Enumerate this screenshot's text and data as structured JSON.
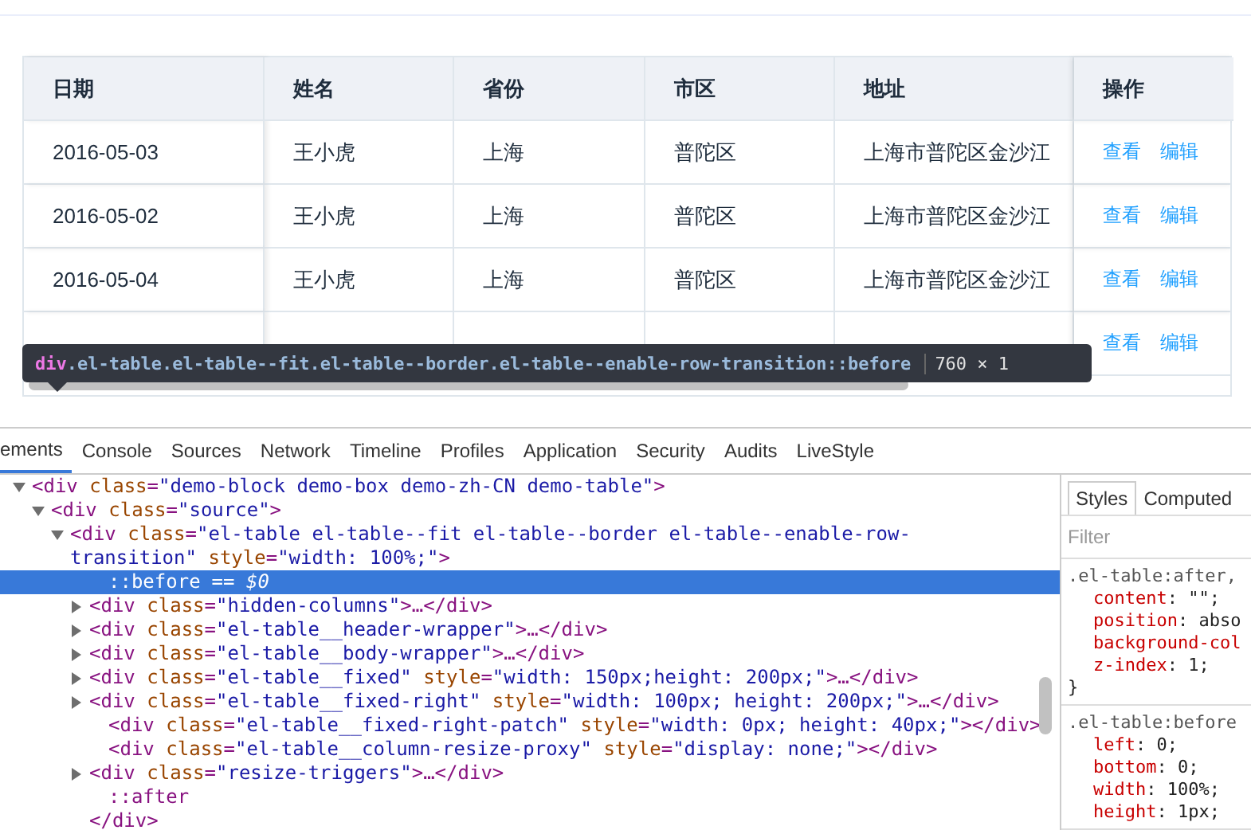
{
  "table": {
    "columns": [
      "日期",
      "姓名",
      "省份",
      "市区",
      "地址",
      "操作"
    ],
    "rows": [
      {
        "cells": [
          "2016-05-03",
          "王小虎",
          "上海",
          "普陀区",
          "上海市普陀区金沙江"
        ],
        "actions": [
          "查看",
          "编辑"
        ]
      },
      {
        "cells": [
          "2016-05-02",
          "王小虎",
          "上海",
          "普陀区",
          "上海市普陀区金沙江"
        ],
        "actions": [
          "查看",
          "编辑"
        ]
      },
      {
        "cells": [
          "2016-05-04",
          "王小虎",
          "上海",
          "普陀区",
          "上海市普陀区金沙江"
        ],
        "actions": [
          "查看",
          "编辑"
        ]
      },
      {
        "actions": [
          "查看",
          "编辑"
        ]
      }
    ]
  },
  "inspect_tooltip": {
    "tag": "div",
    "selector": ".el-table.el-table--fit.el-table--border.el-table--enable-row-transition::before",
    "size": "760 × 1"
  },
  "devtools": {
    "tabs": [
      {
        "label": "ements",
        "selected": true
      },
      {
        "label": "Console",
        "selected": false
      },
      {
        "label": "Sources",
        "selected": false
      },
      {
        "label": "Network",
        "selected": false
      },
      {
        "label": "Timeline",
        "selected": false
      },
      {
        "label": "Profiles",
        "selected": false
      },
      {
        "label": "Application",
        "selected": false
      },
      {
        "label": "Security",
        "selected": false
      },
      {
        "label": "Audits",
        "selected": false
      },
      {
        "label": "LiveStyle",
        "selected": false
      }
    ],
    "dom_tree": [
      {
        "text": "<div class=\"demo-block demo-box demo-zh-CN demo-table\">",
        "expanded": true,
        "selected": false,
        "children": [
          {
            "text": "<div class=\"source\">",
            "expanded": true,
            "selected": false,
            "children": [
              {
                "text": "<div class=\"el-table el-table--fit el-table--border el-table--enable-row-transition\" style=\"width: 100%;\">",
                "expanded": true,
                "selected": false,
                "children": [
                  {
                    "text": "::before",
                    "hint": "== $0",
                    "selected": true
                  },
                  {
                    "text": "<div class=\"hidden-columns\">…</div>",
                    "expanded": false,
                    "selected": false
                  },
                  {
                    "text": "<div class=\"el-table__header-wrapper\">…</div>",
                    "expanded": false,
                    "selected": false
                  },
                  {
                    "text": "<div class=\"el-table__body-wrapper\">…</div>",
                    "expanded": false,
                    "selected": false
                  },
                  {
                    "text": "<div class=\"el-table__fixed\" style=\"width: 150px;height: 200px;\">…</div>",
                    "expanded": false,
                    "selected": false
                  },
                  {
                    "text": "<div class=\"el-table__fixed-right\" style=\"width: 100px; height: 200px;\">…</div>",
                    "expanded": false,
                    "selected": false
                  },
                  {
                    "text": "<div class=\"el-table__fixed-right-patch\" style=\"width: 0px; height: 40px;\"></div>",
                    "selected": false
                  },
                  {
                    "text": "<div class=\"el-table__column-resize-proxy\" style=\"display: none;\"></div>",
                    "selected": false
                  },
                  {
                    "text": "<div class=\"resize-triggers\">…</div>",
                    "expanded": false,
                    "selected": false
                  },
                  {
                    "text": "::after",
                    "selected": false
                  }
                ]
              },
              {
                "text": "</div>",
                "selected": false
              }
            ]
          }
        ]
      }
    ],
    "sidebar_tabs": [
      {
        "label": "Styles",
        "selected": true
      },
      {
        "label": "Computed",
        "selected": false
      }
    ],
    "filter": {
      "placeholder": "Filter"
    },
    "style_rules": [
      {
        "selector": ".el-table:after,",
        "declarations": [
          {
            "property": "content",
            "value": ": \"\";"
          },
          {
            "property": "position",
            "value": ": abso"
          },
          {
            "property": "background-col"
          },
          {
            "property": "z-index",
            "value": ": 1;"
          }
        ],
        "closing": "}"
      },
      {
        "selector": ".el-table:before",
        "declarations": [
          {
            "property": "left",
            "value": ": 0;"
          },
          {
            "property": "bottom",
            "value": ": 0;"
          },
          {
            "property": "width",
            "value": ": 100%;"
          },
          {
            "property": "height",
            "value": ": 1px;"
          }
        ]
      }
    ]
  }
}
